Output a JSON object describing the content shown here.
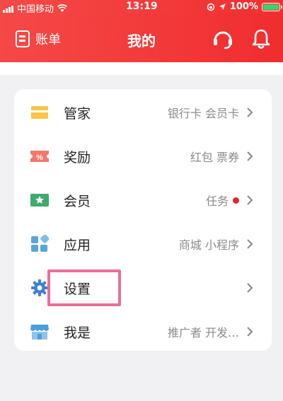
{
  "statusbar": {
    "carrier": "中国移动",
    "time": "13:19",
    "battery": "100%"
  },
  "header": {
    "bill_label": "账单",
    "title": "我的"
  },
  "menu": [
    {
      "label": "管家",
      "detail": "银行卡 会员卡",
      "icon": "wallet-icon",
      "color": "#f7c548"
    },
    {
      "label": "奖励",
      "detail": "红包 票券",
      "icon": "coupon-icon",
      "color": "#f2786c"
    },
    {
      "label": "会员",
      "detail": "任务",
      "has_dot": true,
      "icon": "member-star-icon",
      "color": "#3eaa6e"
    },
    {
      "label": "应用",
      "detail": "商城 小程序",
      "icon": "apps-grid-icon",
      "color": "#5aa5d8"
    },
    {
      "label": "设置",
      "detail": "",
      "icon": "gear-icon",
      "color": "#3f7fd6"
    },
    {
      "label": "我是",
      "detail": "推广者 开发…",
      "icon": "store-icon",
      "color": "#4aa0d8"
    }
  ],
  "colors": {
    "header": "#f23b3a",
    "highlight": "#ec6d98",
    "dot": "#e8262b"
  }
}
